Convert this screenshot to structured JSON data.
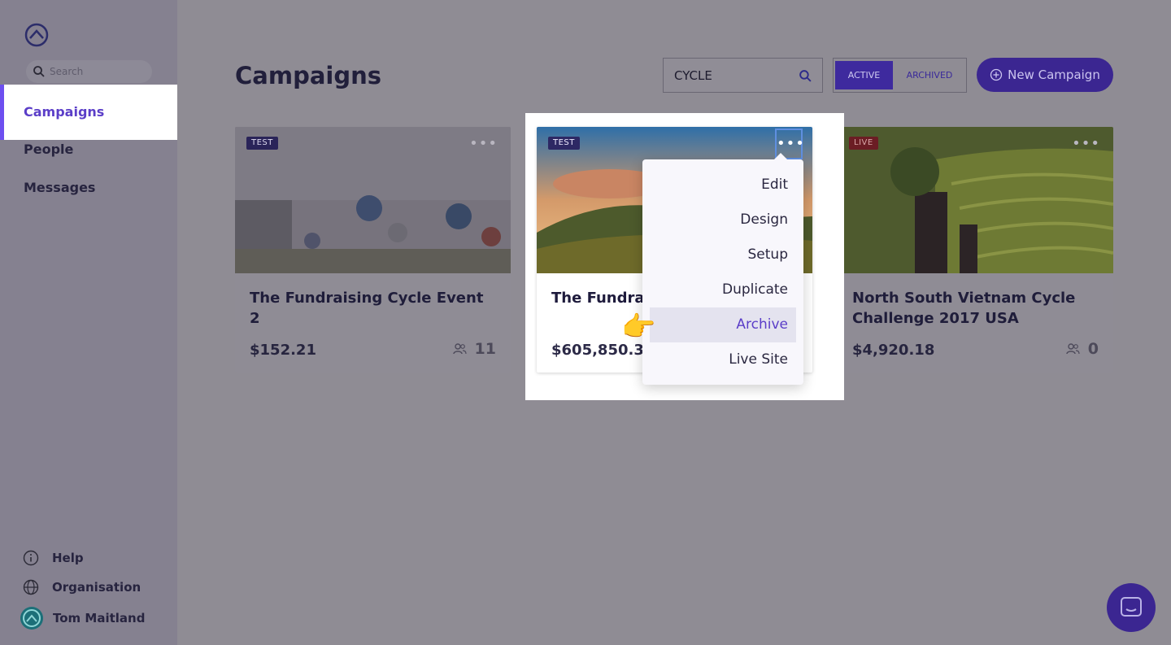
{
  "sidebar": {
    "search_placeholder": "Search",
    "nav": [
      {
        "label": "Campaigns"
      },
      {
        "label": "People"
      },
      {
        "label": "Messages"
      }
    ],
    "bottom": {
      "help": "Help",
      "organisation": "Organisation",
      "user": "Tom Maitland"
    }
  },
  "header": {
    "title": "Campaigns",
    "search_value": "CYCLE",
    "toggle_active": "ACTIVE",
    "toggle_archived": "ARCHIVED",
    "new_campaign": "New Campaign"
  },
  "cards": [
    {
      "badge": "TEST",
      "title": "The Fundraising Cycle Event 2",
      "amount": "$152.21",
      "people": "11"
    },
    {
      "badge": "TEST",
      "title": "The Fundrais",
      "amount": "$605,850.34"
    },
    {
      "badge": "LIVE",
      "title": "North South Vietnam Cycle Challenge 2017 USA",
      "amount": "$4,920.18",
      "people": "0"
    }
  ],
  "menu": {
    "items": [
      {
        "label": "Edit"
      },
      {
        "label": "Design"
      },
      {
        "label": "Setup"
      },
      {
        "label": "Duplicate"
      },
      {
        "label": "Archive"
      },
      {
        "label": "Live Site"
      }
    ]
  },
  "colors": {
    "accent": "#6d4ff0",
    "primary_button": "#3b2691",
    "live_badge": "#6b1d24"
  }
}
